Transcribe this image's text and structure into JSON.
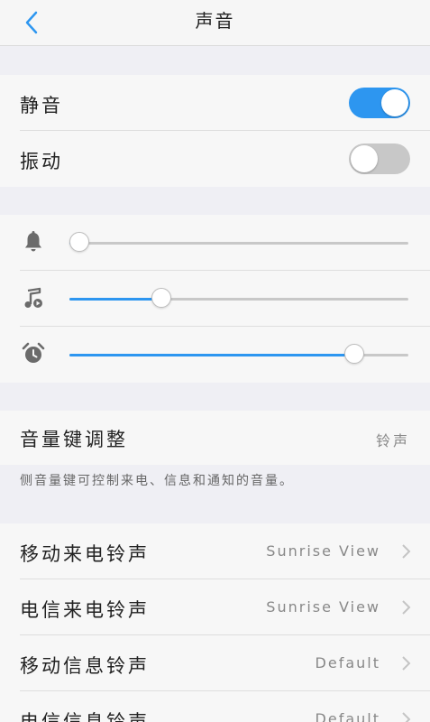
{
  "header": {
    "title": "声音"
  },
  "toggles": [
    {
      "label": "静音",
      "on": true
    },
    {
      "label": "振动",
      "on": false
    }
  ],
  "sliders": [
    {
      "icon": "bell-icon",
      "level": 0.03
    },
    {
      "icon": "music-note-icon",
      "level": 0.27
    },
    {
      "icon": "alarm-clock-icon",
      "level": 0.84
    }
  ],
  "volume_key": {
    "label": "音量键调整",
    "value": "铃声"
  },
  "volume_key_note": "侧音量键可控制来电、信息和通知的音量。",
  "ringtones": [
    {
      "label": "移动来电铃声",
      "value": "Sunrise View"
    },
    {
      "label": "电信来电铃声",
      "value": "Sunrise View"
    },
    {
      "label": "移动信息铃声",
      "value": "Default"
    },
    {
      "label": "电信信息铃声",
      "value": "Default"
    }
  ],
  "colors": {
    "accent": "#2d96f0",
    "track": "#c8c8c8",
    "toggle_off": "#c8c8c8"
  }
}
